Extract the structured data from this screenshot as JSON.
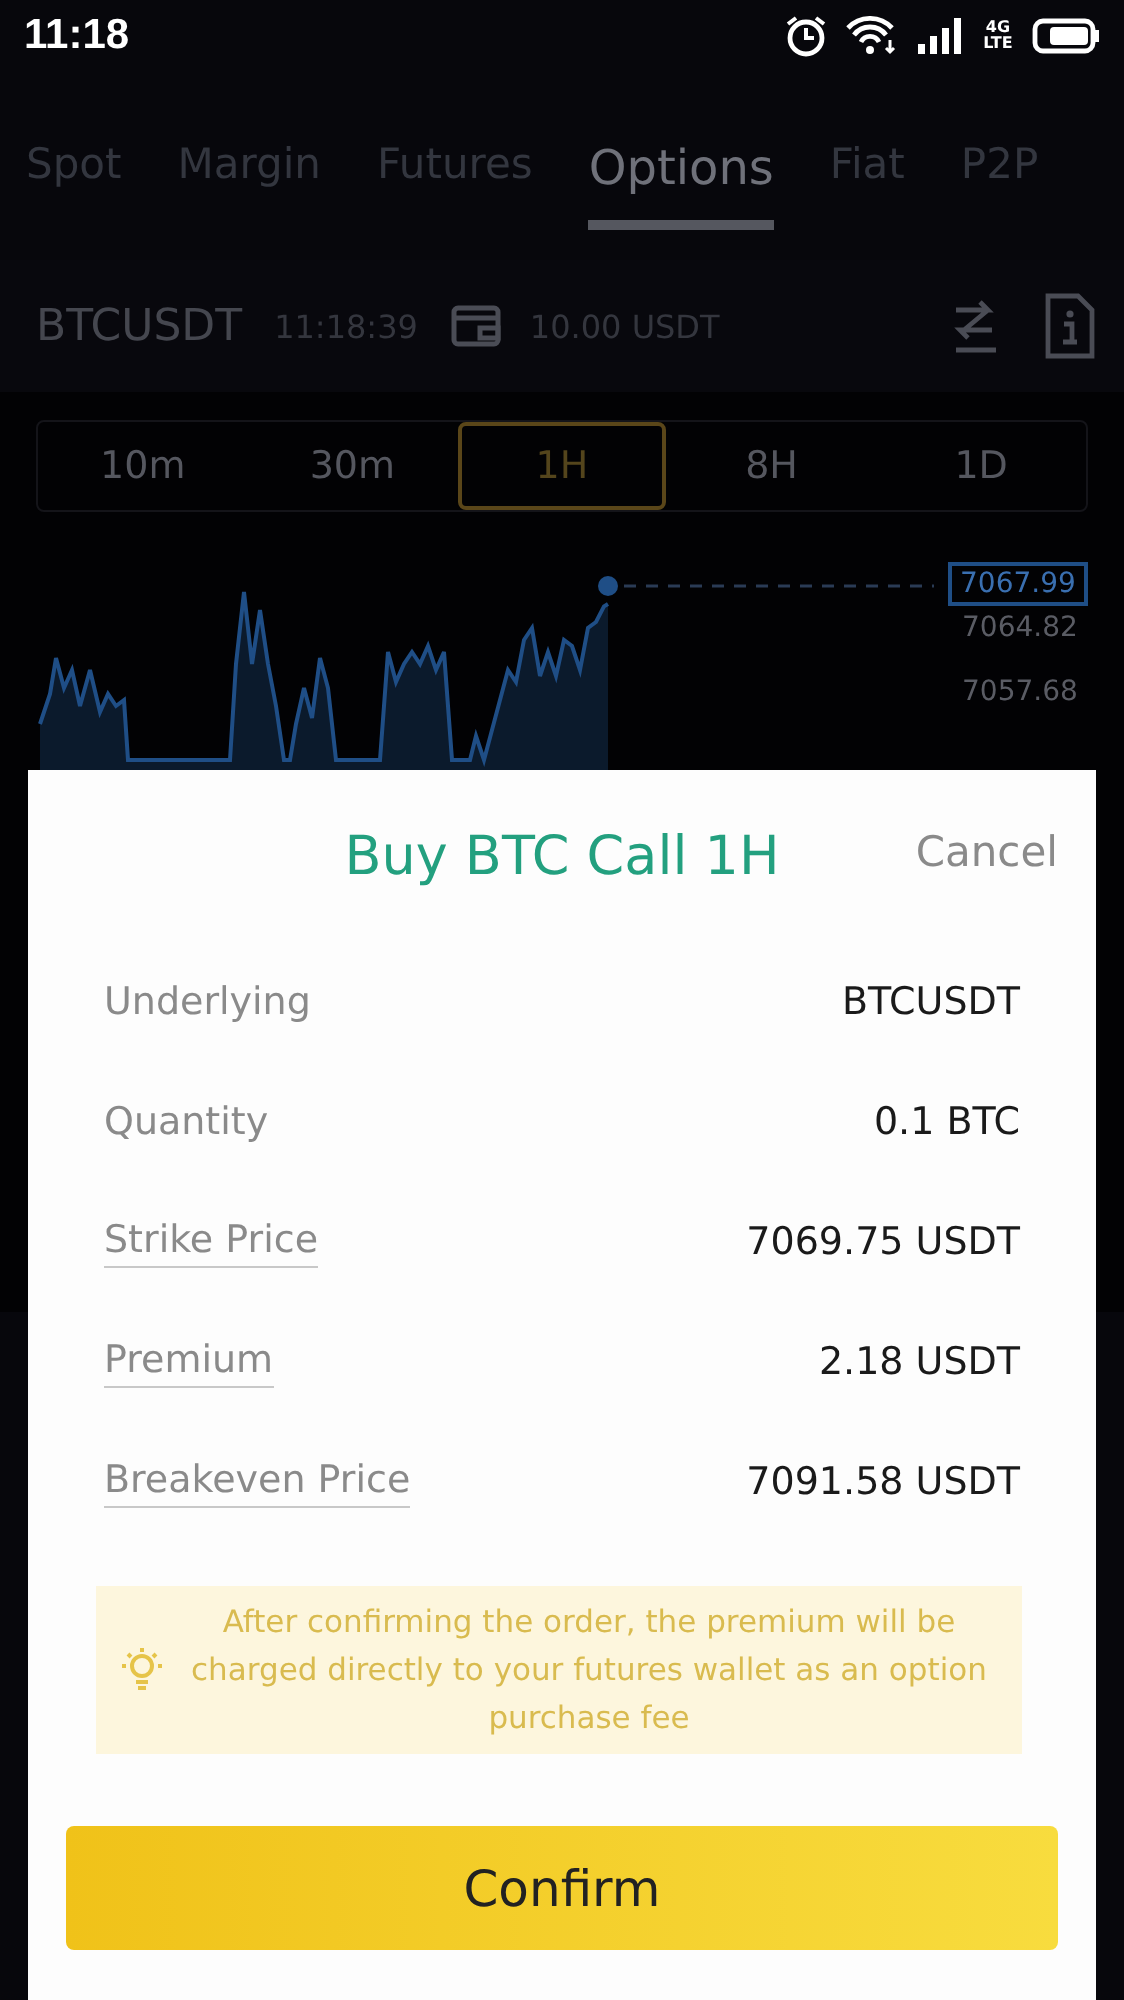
{
  "status_bar": {
    "time": "11:18",
    "network": "4G LTE"
  },
  "tabs": [
    {
      "label": "Spot",
      "selected": false
    },
    {
      "label": "Margin",
      "selected": false
    },
    {
      "label": "Futures",
      "selected": false
    },
    {
      "label": "Options",
      "selected": true
    },
    {
      "label": "Fiat",
      "selected": false
    },
    {
      "label": "P2P",
      "selected": false
    }
  ],
  "ticker": {
    "symbol": "BTCUSDT",
    "time": "11:18:39",
    "balance": "10.00 USDT"
  },
  "intervals": [
    {
      "label": "10m",
      "selected": false
    },
    {
      "label": "30m",
      "selected": false
    },
    {
      "label": "1H",
      "selected": true
    },
    {
      "label": "8H",
      "selected": false
    },
    {
      "label": "1D",
      "selected": false
    }
  ],
  "chart": {
    "current_price": "7067.99",
    "price_labels": [
      "7064.82",
      "7057.68"
    ]
  },
  "dialog": {
    "title": "Buy BTC Call 1H",
    "cancel": "Cancel",
    "rows": [
      {
        "label": "Underlying",
        "value": "BTCUSDT",
        "underlined": false
      },
      {
        "label": "Quantity",
        "value": "0.1 BTC",
        "underlined": false
      },
      {
        "label": "Strike Price",
        "value": "7069.75 USDT",
        "underlined": true
      },
      {
        "label": "Premium",
        "value": "2.18 USDT",
        "underlined": true
      },
      {
        "label": "Breakeven Price",
        "value": "7091.58 USDT",
        "underlined": true
      }
    ],
    "notice": "After confirming the order, the premium will be charged directly to your futures wallet as an option purchase fee",
    "confirm": "Confirm"
  }
}
